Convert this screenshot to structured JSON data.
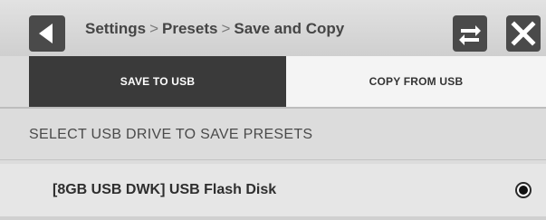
{
  "header": {
    "breadcrumb": [
      "Settings",
      "Presets",
      "Save and Copy"
    ],
    "separator": ">",
    "back_icon": "back-triangle-icon",
    "swap_icon": "swap-arrows-icon",
    "close_icon": "close-x-icon"
  },
  "tabs": [
    {
      "label": "SAVE TO USB",
      "active": true
    },
    {
      "label": "COPY FROM USB",
      "active": false
    }
  ],
  "section": {
    "title": "SELECT USB DRIVE TO SAVE PRESETS"
  },
  "drives": [
    {
      "label": "[8GB USB DWK] USB Flash Disk",
      "selected": true
    }
  ],
  "colors": {
    "active_tab_bg": "#3a3a3a",
    "inactive_tab_bg": "#f4f4f4",
    "button_bg": "#4a4a4a"
  }
}
